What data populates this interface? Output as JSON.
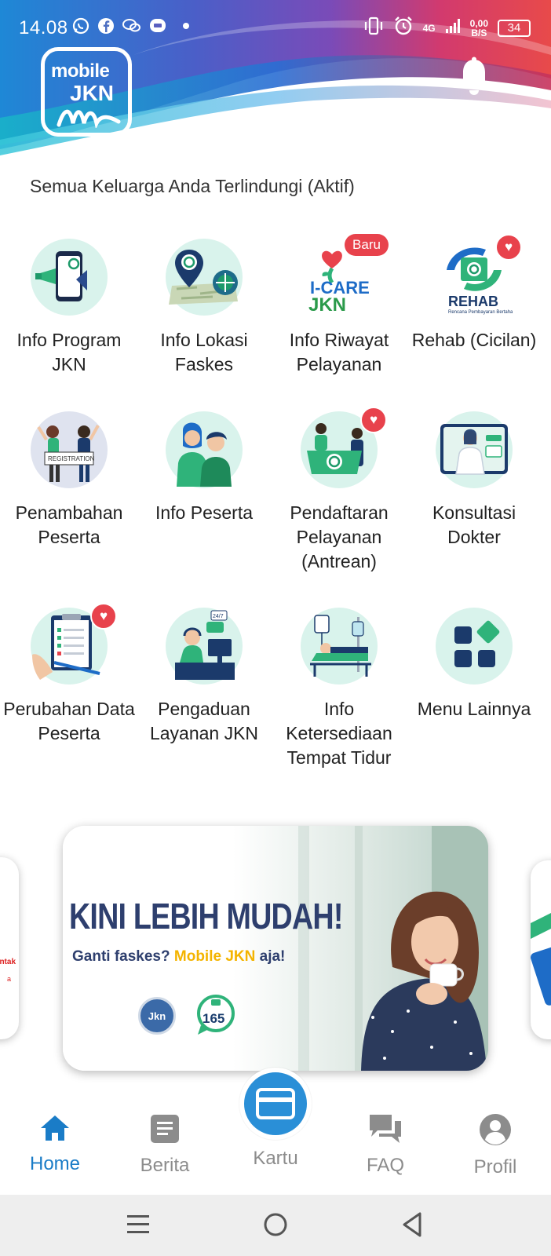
{
  "status_bar": {
    "time": "14.08",
    "network": "4G",
    "speed_value": "0,00",
    "speed_unit": "B/S",
    "battery": "34",
    "icons": [
      "whatsapp-icon",
      "facebook-icon",
      "wechat-icon",
      "chat-bubble-icon",
      "dot-icon",
      "vibrate-icon",
      "alarm-icon",
      "signal-icon"
    ]
  },
  "header": {
    "logo_text_top": "mobile",
    "logo_text_bottom": "JKN",
    "bell_icon": "bell-icon"
  },
  "member_status": "Semua Keluarga Anda Terlindungi (Aktif)",
  "menu": {
    "items": [
      {
        "label": "Info Program JKN",
        "icon": "megaphone-phone-icon"
      },
      {
        "label": "Info Lokasi Faskes",
        "icon": "map-pin-icon"
      },
      {
        "label": "Info Riwayat Pelayanan",
        "icon": "icare-jkn-icon",
        "badge": "Baru"
      },
      {
        "label": "Rehab (Cicilan)",
        "icon": "rehab-icon",
        "badge": "heart"
      },
      {
        "label": "Penambahan Peserta",
        "icon": "registration-icon",
        "sign_text": "REGISTRATION"
      },
      {
        "label": "Info Peserta",
        "icon": "participants-icon"
      },
      {
        "label": "Pendaftaran Pelayanan (Antrean)",
        "icon": "queue-registration-icon",
        "badge": "heart"
      },
      {
        "label": "Konsultasi Dokter",
        "icon": "doctor-consult-icon"
      },
      {
        "label": "Perubahan Data Peserta",
        "icon": "update-data-icon",
        "badge": "heart"
      },
      {
        "label": "Pengaduan Layanan JKN",
        "icon": "call-center-icon"
      },
      {
        "label": "Info Ketersediaan Tempat Tidur",
        "icon": "hospital-bed-icon"
      },
      {
        "label": "Menu Lainnya",
        "icon": "grid-menu-icon"
      }
    ]
  },
  "banner": {
    "headline": "KINI LEBIH MUDAH!",
    "sub_prefix": "Ganti faskes? ",
    "sub_highlight": "Mobile JKN",
    "sub_suffix": " aja!",
    "logo_left_text": "Jkn",
    "logo_right_number": "165"
  },
  "side_card_left": {
    "fragment": "ntak",
    "fragment2": "a"
  },
  "bottom_nav": {
    "items": [
      {
        "label": "Home",
        "icon": "home-icon",
        "active": true
      },
      {
        "label": "Berita",
        "icon": "news-icon",
        "active": false
      },
      {
        "label": "Kartu",
        "icon": "card-icon",
        "active": false
      },
      {
        "label": "FAQ",
        "icon": "faq-chat-icon",
        "active": false
      },
      {
        "label": "Profil",
        "icon": "profile-icon",
        "active": false
      }
    ]
  },
  "colors": {
    "accent": "#1a7cc7",
    "mint": "#d9f3ec",
    "badge_red": "#e8424c",
    "banner_navy": "#2e3f6e",
    "banner_yellow": "#f4b400"
  }
}
